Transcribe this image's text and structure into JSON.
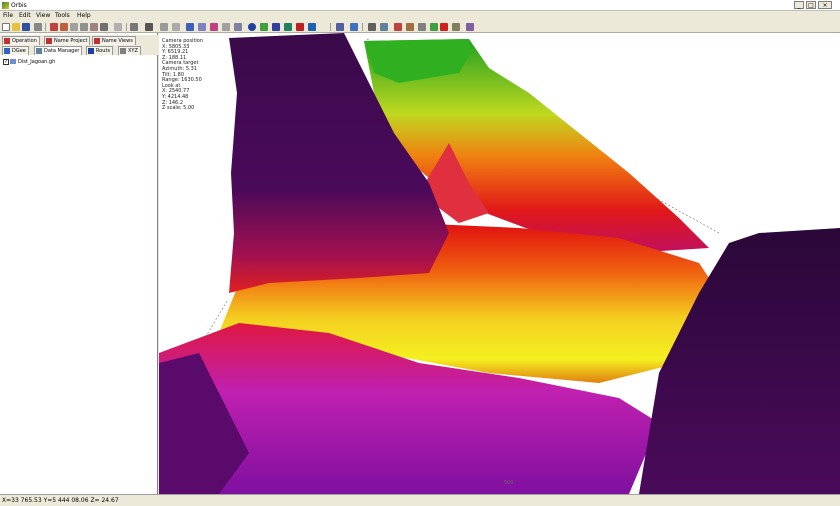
{
  "window": {
    "title": "Orbis"
  },
  "window_controls": {
    "minimize": "_",
    "maximize": "□",
    "close": "×"
  },
  "menu": [
    "File",
    "Edit",
    "View",
    "Tools",
    "Help"
  ],
  "toolbar": {
    "icons": [
      "new-icon",
      "open-icon",
      "save-icon",
      "print-icon",
      "zoom-in-icon",
      "zoom-out-icon",
      "zoom-extent-icon",
      "pan-icon",
      "rotate-icon",
      "refresh-icon",
      "select-icon",
      "measure-icon",
      "profile-icon",
      "info-icon",
      "grid-icon",
      "layer-icon",
      "lighting-icon",
      "contour-icon",
      "help-icon"
    ]
  },
  "left_panel": {
    "tabs_row1": [
      {
        "label": "Operation",
        "icon": "operation-icon"
      },
      {
        "label": "Name Project",
        "icon": "project-icon"
      },
      {
        "label": "Name Views",
        "icon": "views-icon"
      }
    ],
    "tabs_row2": [
      {
        "label": "DGee",
        "icon": "dgee-icon"
      },
      {
        "label": "Data Manager",
        "icon": "data-manager-icon"
      },
      {
        "label": "Routs",
        "icon": "routs-icon"
      },
      {
        "label": "XYZ",
        "icon": "xyz-icon"
      }
    ],
    "tree": [
      {
        "label": "Dist_Jagoan.gh",
        "checked": true,
        "check_mark": "✓"
      }
    ]
  },
  "viewport": {
    "info_lines": [
      "Camera position",
      "X: 5805.33",
      "Y: 6519.21",
      "Z: 188.11",
      "Camera target",
      "Azimuth: 5.31",
      "Tilt: 1.80",
      "Range: 1630.50",
      "Look at",
      "X: 2540.77",
      "Y: 4214.48",
      "Z: 146.2",
      "Z scale: 5.00"
    ],
    "scale_label": "500",
    "colors": {
      "purple": "#4a0a5a",
      "magenta": "#b020c0",
      "red": "#e81818",
      "orange": "#f47a10",
      "yellow": "#f4f020",
      "green": "#30b020"
    }
  },
  "status": {
    "text": "X=33 765.53   Y=5 444 08.06   Z= 24.67"
  }
}
